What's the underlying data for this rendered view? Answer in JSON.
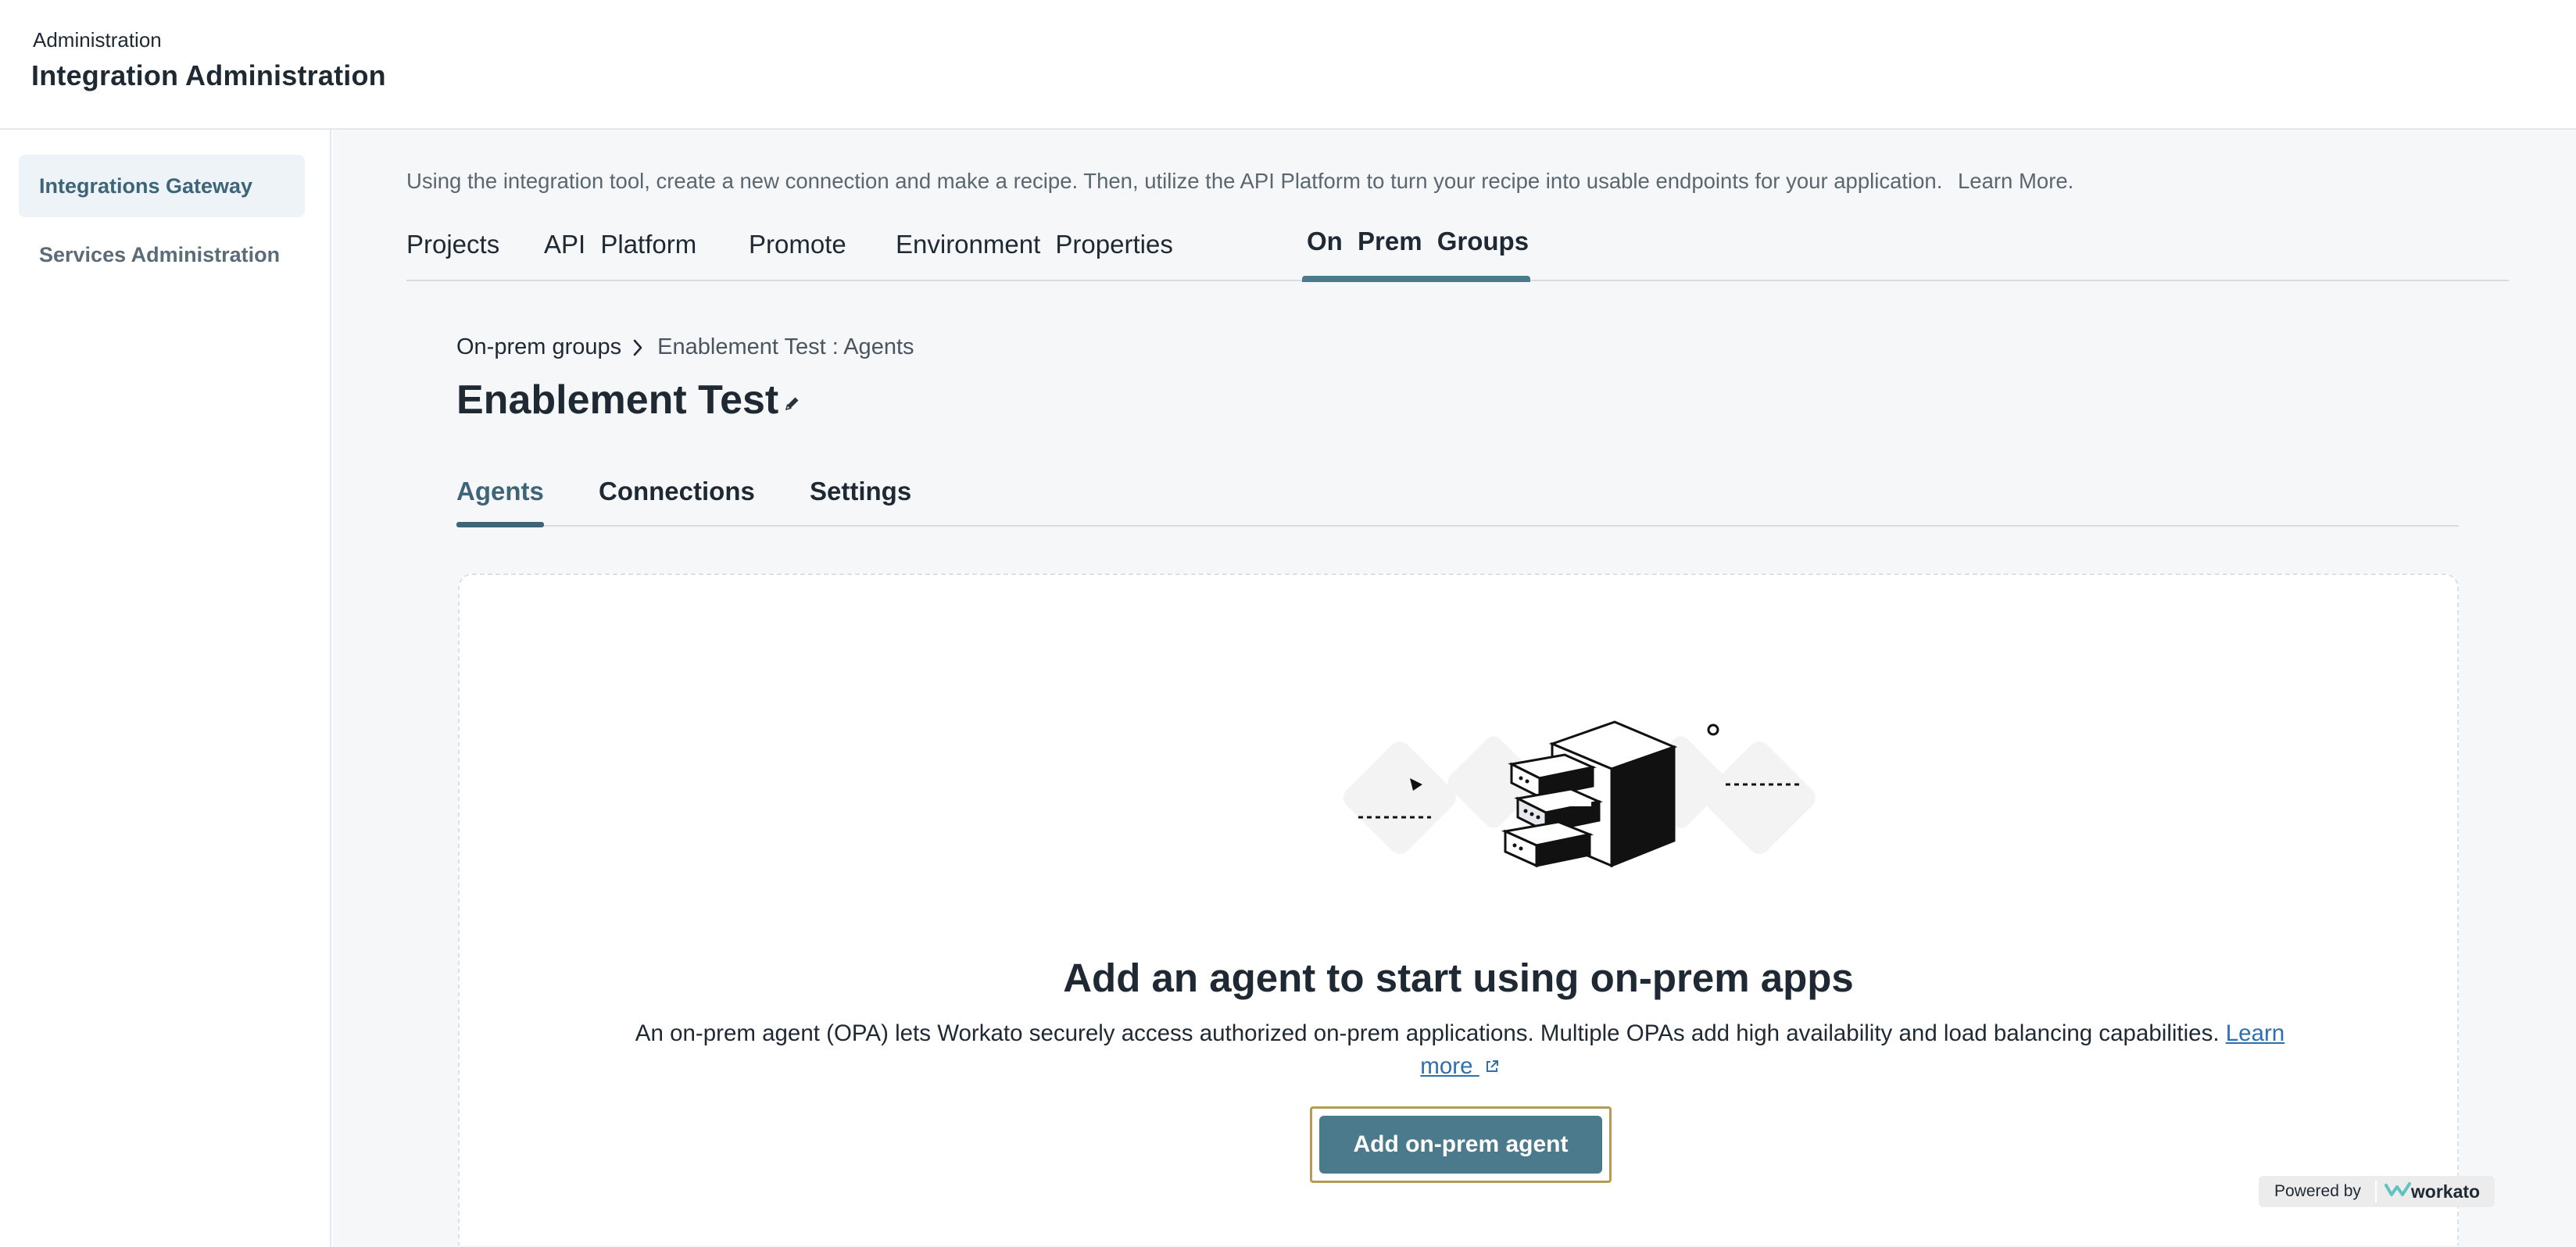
{
  "header": {
    "kicker": "Administration",
    "title": "Integration Administration"
  },
  "sidebar": {
    "items": [
      {
        "label": "Integrations Gateway",
        "active": true
      },
      {
        "label": "Services Administration",
        "active": false
      }
    ]
  },
  "main": {
    "intro_text": "Using the integration tool, create a new connection and make a recipe. Then, utilize the API Platform to turn your recipe into usable endpoints for your application.",
    "intro_link": "Learn More.",
    "top_tabs": [
      {
        "label": "Projects"
      },
      {
        "label": "API Platform"
      },
      {
        "label": "Promote"
      },
      {
        "label": "Environment Properties"
      },
      {
        "label": "On Prem Groups",
        "active": true
      }
    ]
  },
  "breadcrumb": {
    "parent": "On-prem groups",
    "current": "Enablement Test : Agents"
  },
  "page": {
    "title": "Enablement Test"
  },
  "sub_tabs": [
    {
      "label": "Agents",
      "active": true
    },
    {
      "label": "Connections"
    },
    {
      "label": "Settings"
    }
  ],
  "empty_state": {
    "title": "Add an agent to start using on-prem apps",
    "description": "An on-prem agent (OPA) lets Workato securely access authorized on-prem applications. Multiple OPAs add high availability and load balancing capabilities.",
    "learn_more": "Learn more",
    "cta": "Add on-prem agent"
  },
  "footer": {
    "powered_by": "Powered by",
    "brand": "workato"
  },
  "colors": {
    "accent": "#4a7a8c",
    "accent_dark": "#3d6577",
    "focus_outline": "#b79a54",
    "link": "#2f6fb0"
  },
  "icons": [
    "chevron-right-icon",
    "pencil-icon",
    "external-link-icon",
    "server-illustration",
    "workato-logo-icon"
  ]
}
